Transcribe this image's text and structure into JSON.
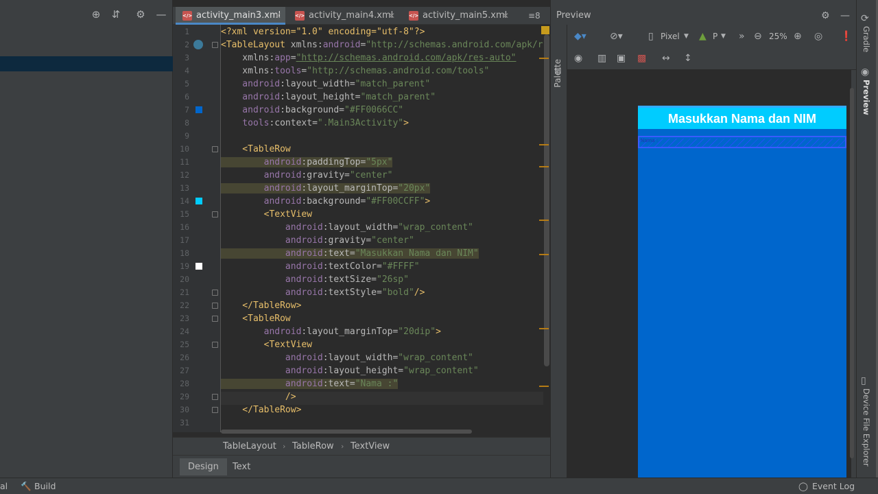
{
  "editor": {
    "tabs": [
      {
        "label": "activity_main3.xml",
        "active": true
      },
      {
        "label": "activity_main4.xml",
        "active": false
      },
      {
        "label": "activity_main5.xml",
        "active": false
      }
    ],
    "tab_overflow": "≡8",
    "line_numbers": [
      "1",
      "2",
      "3",
      "4",
      "5",
      "6",
      "7",
      "8",
      "9",
      "10",
      "11",
      "12",
      "13",
      "14",
      "15",
      "16",
      "17",
      "18",
      "19",
      "20",
      "21",
      "22",
      "23",
      "24",
      "25",
      "26",
      "27",
      "28",
      "29",
      "30",
      "31"
    ],
    "code_lines": [
      {
        "n": "1",
        "parts": [
          [
            "c-decl",
            "<?xml version=\"1.0\" encoding=\"utf-8\"?>"
          ]
        ]
      },
      {
        "n": "2",
        "parts": [
          [
            "c-tag",
            "<TableLayout "
          ],
          [
            "c-attr",
            "xmlns:"
          ],
          [
            "c-ns",
            "android"
          ],
          [
            "c-attr",
            "="
          ],
          [
            "c-val",
            "\"http://schemas.android.com/apk/re"
          ]
        ]
      },
      {
        "n": "3",
        "parts": [
          [
            "c-attr",
            "    xmlns:"
          ],
          [
            "c-ns",
            "app"
          ],
          [
            "c-attr",
            "="
          ],
          [
            "c-val ul",
            "\"http://schemas.android.com/apk/res-auto\""
          ]
        ]
      },
      {
        "n": "4",
        "parts": [
          [
            "c-attr",
            "    xmlns:"
          ],
          [
            "c-ns",
            "tools"
          ],
          [
            "c-attr",
            "="
          ],
          [
            "c-val",
            "\"http://schemas.android.com/tools\""
          ]
        ]
      },
      {
        "n": "5",
        "parts": [
          [
            "c-ns",
            "    android"
          ],
          [
            "c-attr",
            ":layout_width="
          ],
          [
            "c-val",
            "\"match_parent\""
          ]
        ]
      },
      {
        "n": "6",
        "parts": [
          [
            "c-ns",
            "    android"
          ],
          [
            "c-attr",
            ":layout_height="
          ],
          [
            "c-val",
            "\"match_parent\""
          ]
        ]
      },
      {
        "n": "7",
        "parts": [
          [
            "c-ns",
            "    android"
          ],
          [
            "c-attr",
            ":background="
          ],
          [
            "c-val",
            "\"#FF0066CC\""
          ]
        ]
      },
      {
        "n": "8",
        "parts": [
          [
            "c-ns",
            "    tools"
          ],
          [
            "c-attr",
            ":context="
          ],
          [
            "c-val",
            "\".Main3Activity\""
          ],
          [
            "c-tag",
            ">"
          ]
        ]
      },
      {
        "n": "9",
        "parts": []
      },
      {
        "n": "10",
        "parts": [
          [
            "c-tag",
            "    <TableRow"
          ]
        ]
      },
      {
        "n": "11",
        "parts": [
          [
            "c-ns hl",
            "        android"
          ],
          [
            "c-attr hl",
            ":paddingTop="
          ],
          [
            "c-val hl",
            "\"5px\""
          ]
        ]
      },
      {
        "n": "12",
        "parts": [
          [
            "c-ns",
            "        android"
          ],
          [
            "c-attr",
            ":gravity="
          ],
          [
            "c-val",
            "\"center\""
          ]
        ]
      },
      {
        "n": "13",
        "parts": [
          [
            "c-ns hl",
            "        android"
          ],
          [
            "c-attr hl",
            ":layout_marginTop="
          ],
          [
            "c-val hl",
            "\"20px\""
          ]
        ]
      },
      {
        "n": "14",
        "parts": [
          [
            "c-ns",
            "        android"
          ],
          [
            "c-attr",
            ":background="
          ],
          [
            "c-val",
            "\"#FF00CCFF\""
          ],
          [
            "c-tag",
            ">"
          ]
        ]
      },
      {
        "n": "15",
        "parts": [
          [
            "c-tag",
            "        <TextView"
          ]
        ]
      },
      {
        "n": "16",
        "parts": [
          [
            "c-ns",
            "            android"
          ],
          [
            "c-attr",
            ":layout_width="
          ],
          [
            "c-val",
            "\"wrap_content\""
          ]
        ]
      },
      {
        "n": "17",
        "parts": [
          [
            "c-ns",
            "            android"
          ],
          [
            "c-attr",
            ":gravity="
          ],
          [
            "c-val",
            "\"center\""
          ]
        ]
      },
      {
        "n": "18",
        "parts": [
          [
            "c-ns hl",
            "            android"
          ],
          [
            "c-attr hl",
            ":text="
          ],
          [
            "c-val hl",
            "\"Masukkan Nama dan NIM\""
          ]
        ]
      },
      {
        "n": "19",
        "parts": [
          [
            "c-ns",
            "            android"
          ],
          [
            "c-attr",
            ":textColor="
          ],
          [
            "c-val",
            "\"#FFFF\""
          ]
        ]
      },
      {
        "n": "20",
        "parts": [
          [
            "c-ns",
            "            android"
          ],
          [
            "c-attr",
            ":textSize="
          ],
          [
            "c-val",
            "\"26sp\""
          ]
        ]
      },
      {
        "n": "21",
        "parts": [
          [
            "c-ns",
            "            android"
          ],
          [
            "c-attr",
            ":textStyle="
          ],
          [
            "c-val",
            "\"bold\""
          ],
          [
            "c-tag",
            "/>"
          ]
        ]
      },
      {
        "n": "22",
        "parts": [
          [
            "c-tag",
            "    </TableRow>"
          ]
        ]
      },
      {
        "n": "23",
        "parts": [
          [
            "c-tag",
            "    <TableRow"
          ]
        ]
      },
      {
        "n": "24",
        "parts": [
          [
            "c-ns",
            "        android"
          ],
          [
            "c-attr",
            ":layout_marginTop="
          ],
          [
            "c-val",
            "\"20dip\""
          ],
          [
            "c-tag",
            ">"
          ]
        ]
      },
      {
        "n": "25",
        "parts": [
          [
            "c-tag",
            "        <TextView"
          ]
        ]
      },
      {
        "n": "26",
        "parts": [
          [
            "c-ns",
            "            android"
          ],
          [
            "c-attr",
            ":layout_width="
          ],
          [
            "c-val",
            "\"wrap_content\""
          ]
        ]
      },
      {
        "n": "27",
        "parts": [
          [
            "c-ns",
            "            android"
          ],
          [
            "c-attr",
            ":layout_height="
          ],
          [
            "c-val",
            "\"wrap_content\""
          ]
        ]
      },
      {
        "n": "28",
        "parts": [
          [
            "c-ns hl",
            "            android"
          ],
          [
            "c-attr hl",
            ":text="
          ],
          [
            "c-val hl",
            "\"Nama :\""
          ]
        ]
      },
      {
        "n": "29",
        "parts": [
          [
            "c-tag",
            "            />"
          ]
        ]
      },
      {
        "n": "30",
        "parts": [
          [
            "c-tag",
            "    </TableRow>"
          ]
        ]
      },
      {
        "n": "31",
        "parts": []
      }
    ],
    "breadcrumb": [
      "TableLayout",
      "TableRow",
      "TextView"
    ],
    "mode_tabs": [
      {
        "label": "Design",
        "active": true
      },
      {
        "label": "Text",
        "active": false
      }
    ],
    "gutter_colors": {
      "line7": "#0066cc",
      "line14": "#00ccff",
      "line19": "#ffffff"
    }
  },
  "preview": {
    "title": "Preview",
    "palette_label": "Palette",
    "device": "Pixel",
    "api": "P",
    "zoom": "25%",
    "device_title": "Masukkan Nama dan NIM",
    "device_row2_text": "Nama :",
    "colors": {
      "background": "#0066cc",
      "title_row": "#00ccff"
    }
  },
  "right_strip": {
    "gradle": "Gradle",
    "preview": "Preview",
    "device_file_explorer": "Device File Explorer"
  },
  "status_bar": {
    "left": "al",
    "build": "Build",
    "event_log": "Event Log"
  }
}
